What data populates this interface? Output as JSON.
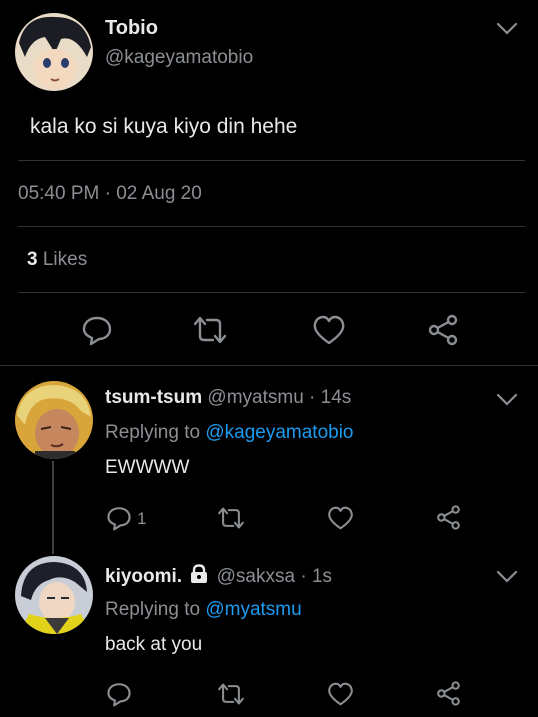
{
  "main_tweet": {
    "display_name": "Tobio",
    "handle": "@kageyamatobio",
    "text": "kala ko si kuya kiyo din hehe",
    "time": "05:40 PM · 02 Aug 20",
    "likes_count": "3",
    "likes_label": "Likes"
  },
  "replies": [
    {
      "display_name": "tsum-tsum",
      "handle": "@myatsmu",
      "time": "· 14s",
      "replying_prefix": "Replying to",
      "replying_to": "@kageyamatobio",
      "text": "EWWWW",
      "reply_count": "1"
    },
    {
      "display_name": "kiyoomi.",
      "handle": "@sakxsa",
      "time": "· 1s",
      "replying_prefix": "Replying to",
      "replying_to": "@myatsmu",
      "text": "back at you",
      "reply_count": ""
    }
  ],
  "icons": {
    "reply": "reply-icon",
    "retweet": "retweet-icon",
    "like": "heart-icon",
    "share": "share-icon",
    "menu": "chevron-down-icon",
    "lock": "lock-icon"
  },
  "colors": {
    "background": "#000000",
    "link": "#1d9bf0",
    "secondary_text": "#8b8f94",
    "divider": "#2f3336"
  }
}
